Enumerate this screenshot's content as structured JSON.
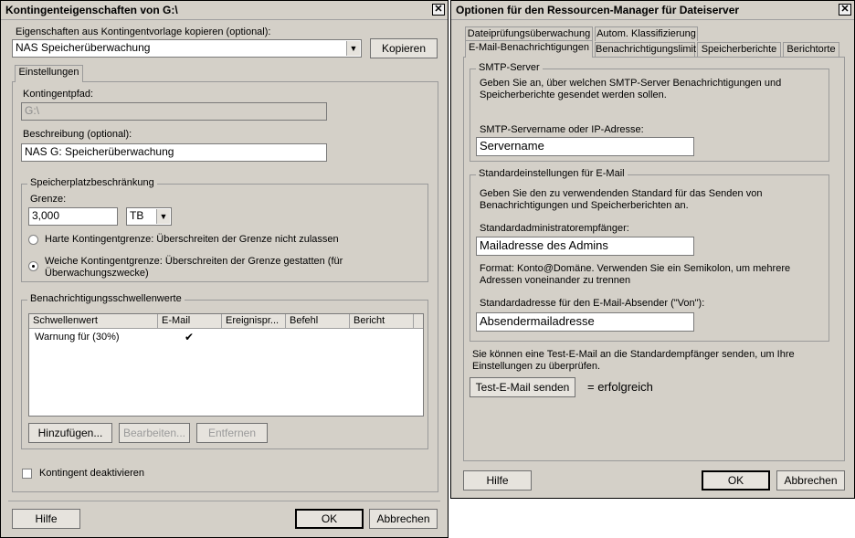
{
  "left": {
    "title": "Kontingenteigenschaften von G:\\",
    "close_glyph": "✕",
    "template_label": "Eigenschaften aus Kontingentvorlage kopieren (optional):",
    "template_value": "NAS Speicherüberwachung",
    "copy_button": "Kopieren",
    "tab_settings": "Einstellungen",
    "path_label": "Kontingentpfad:",
    "path_value": "G:\\",
    "desc_label": "Beschreibung (optional):",
    "desc_value": "NAS G: Speicherüberwachung",
    "limit_group": "Speicherplatzbeschränkung",
    "limit_label": "Grenze:",
    "limit_value": "3,000",
    "unit_value": "TB",
    "hard_label": "Harte Kontingentgrenze: Überschreiten der Grenze nicht zulassen",
    "soft_label": "Weiche Kontingentgrenze: Überschreiten der Grenze gestatten (für Überwachungszwecke)",
    "threshold_group": "Benachrichtigungsschwellenwerte",
    "columns": [
      "Schwellenwert",
      "E-Mail",
      "Ereignispr...",
      "Befehl",
      "Bericht"
    ],
    "rows": [
      {
        "threshold": "Warnung für (30%)",
        "email": "✔",
        "event": "",
        "command": "",
        "report": ""
      }
    ],
    "add_button": "Hinzufügen...",
    "edit_button": "Bearbeiten...",
    "remove_button": "Entfernen",
    "disable_label": "Kontingent deaktivieren",
    "help_button": "Hilfe",
    "ok_button": "OK",
    "cancel_button": "Abbrechen"
  },
  "right": {
    "title": "Optionen für den Ressourcen-Manager für Dateiserver",
    "close_glyph": "✕",
    "tabs_row1": [
      "Dateiprüfungsüberwachung",
      "Autom. Klassifizierung"
    ],
    "tabs_row2": [
      "E-Mail-Benachrichtigungen",
      "Benachrichtigungslimit",
      "Speicherberichte",
      "Berichtorte"
    ],
    "smtp_group": "SMTP-Server",
    "smtp_desc": "Geben Sie an, über welchen SMTP-Server Benachrichtigungen und Speicherberichte gesendet werden sollen.",
    "smtp_label": "SMTP-Servername oder IP-Adresse:",
    "smtp_value": "Servername",
    "email_group": "Standardeinstellungen für E-Mail",
    "email_desc": "Geben Sie den zu verwendenden Standard für das Senden von Benachrichtigungen und Speicherberichten an.",
    "admin_label": "Standardadministratorempfänger:",
    "admin_value": "Mailadresse des Admins",
    "format_text": "Format: Konto@Domäne. Verwenden Sie ein Semikolon, um mehrere Adressen voneinander zu trennen",
    "sender_label": "Standardadresse für den E-Mail-Absender (\"Von\"):",
    "sender_value": "Absendermailadresse",
    "test_desc": "Sie können eine Test-E-Mail an die Standardempfänger senden, um Ihre Einstellungen zu überprüfen.",
    "test_button": "Test-E-Mail senden",
    "test_result": "= erfolgreich",
    "help_button": "Hilfe",
    "ok_button": "OK",
    "cancel_button": "Abbrechen"
  }
}
